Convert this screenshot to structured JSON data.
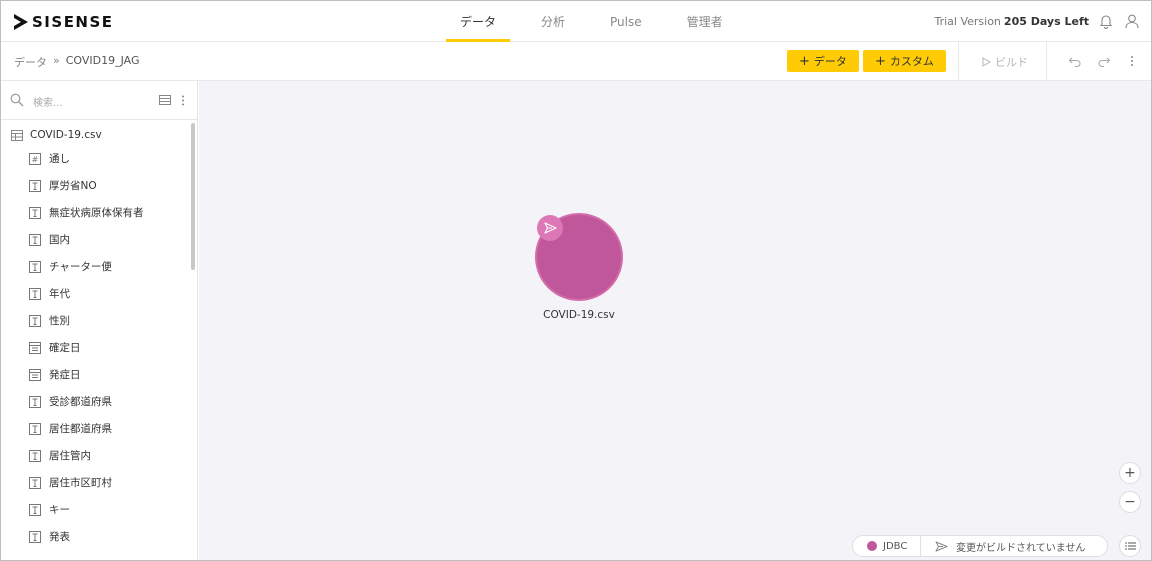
{
  "header": {
    "logo_text": "SISENSE",
    "nav": [
      {
        "label": "データ",
        "active": true
      },
      {
        "label": "分析",
        "active": false
      },
      {
        "label": "Pulse",
        "active": false
      },
      {
        "label": "管理者",
        "active": false
      }
    ],
    "trial_label": "Trial Version",
    "days_left": "205 Days Left",
    "accent_color": "#ffcb05"
  },
  "toolbar": {
    "breadcrumb_root": "データ",
    "breadcrumb_sep": "»",
    "breadcrumb_current": "COVID19_JAG",
    "add_data_label": "データ",
    "add_custom_label": "カスタム",
    "build_label": "ビルド"
  },
  "sidebar": {
    "search_placeholder": "検索...",
    "table_name": "COVID-19.csv",
    "columns": [
      {
        "label": "通し",
        "type": "number"
      },
      {
        "label": "厚労省NO",
        "type": "text"
      },
      {
        "label": "無症状病原体保有者",
        "type": "text"
      },
      {
        "label": "国内",
        "type": "text"
      },
      {
        "label": "チャーター便",
        "type": "text"
      },
      {
        "label": "年代",
        "type": "text"
      },
      {
        "label": "性別",
        "type": "text"
      },
      {
        "label": "確定日",
        "type": "date"
      },
      {
        "label": "発症日",
        "type": "date"
      },
      {
        "label": "受診都道府県",
        "type": "text"
      },
      {
        "label": "居住都道府県",
        "type": "text"
      },
      {
        "label": "居住管内",
        "type": "text"
      },
      {
        "label": "居住市区町村",
        "type": "text"
      },
      {
        "label": "キー",
        "type": "text"
      },
      {
        "label": "発表",
        "type": "text"
      }
    ]
  },
  "canvas": {
    "node_label": "COVID-19.csv",
    "node_color": "#c0579a",
    "zoom_in": "+",
    "zoom_out": "−"
  },
  "status_bar": {
    "connector": "JDBC",
    "message": "変更がビルドされていません"
  }
}
